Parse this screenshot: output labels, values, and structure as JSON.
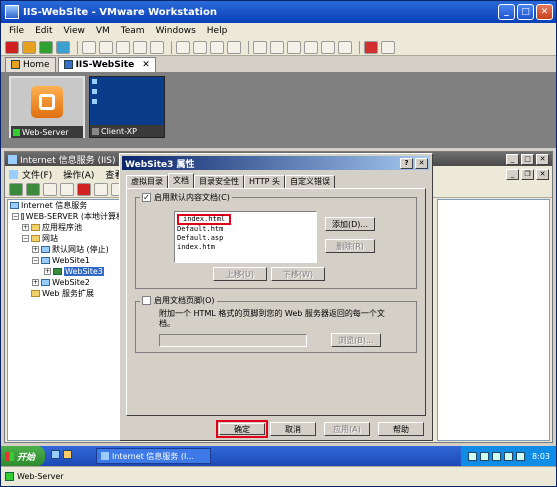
{
  "window": {
    "title": "IIS-WebSite - VMware Workstation",
    "menu": [
      "File",
      "Edit",
      "View",
      "VM",
      "Team",
      "Windows",
      "Help"
    ],
    "controls": {
      "minimize": "_",
      "maximize": "□",
      "close": "✕"
    }
  },
  "tabs": [
    {
      "label": "Home",
      "close": ""
    },
    {
      "label": "IIS-WebSite",
      "close": "✕"
    }
  ],
  "thumbnails": [
    {
      "label": "Web-Server"
    },
    {
      "label": "Client-XP"
    }
  ],
  "iis": {
    "title": "Internet 信息服务 (IIS)",
    "menu": [
      "文件(F)",
      "操作(A)",
      "查看"
    ],
    "tree": [
      {
        "label": "Internet 信息服务",
        "level": 0
      },
      {
        "label": "WEB-SERVER (本地计算机",
        "level": 1
      },
      {
        "label": "应用程序池",
        "level": 2
      },
      {
        "label": "网站",
        "level": 2
      },
      {
        "label": "默认网站 (停止)",
        "level": 3
      },
      {
        "label": "WebSite1",
        "level": 3
      },
      {
        "label": "WebSite3",
        "level": 4
      },
      {
        "label": "WebSite2",
        "level": 3
      },
      {
        "label": "Web 服务扩展",
        "level": 2
      }
    ]
  },
  "dialog": {
    "title": "WebSite3 属性",
    "help": "?",
    "close": "✕",
    "tabs": [
      "虚拟目录",
      "文档",
      "目录安全性",
      "HTTP 头",
      "自定义错误"
    ],
    "enable_default": "启用默认内容文档(C)",
    "check_mark": "✓",
    "documents": [
      "index.html",
      "Default.htm",
      "Default.asp",
      "index.htm"
    ],
    "add_button": "添加(D)...",
    "remove_button": "删除(R)",
    "move_up": "上移(U)",
    "move_down": "下移(W)",
    "enable_footer": "启用文档页脚(O)",
    "footer_desc": "附加一个 HTML 格式的页脚到您的 Web 服务器返回的每一个文档。",
    "browse_button": "浏览(B)...",
    "ok": "确定",
    "cancel": "取消",
    "apply": "应用(A)",
    "help_button": "帮助"
  },
  "taskbar": {
    "start": "开始",
    "task": "Internet 信息服务 (I...",
    "time": "8:03"
  },
  "status": {
    "vm_name": "Web-Server"
  },
  "colors": {
    "highlight": "#e0001a",
    "titlebar": "#0a246a"
  }
}
